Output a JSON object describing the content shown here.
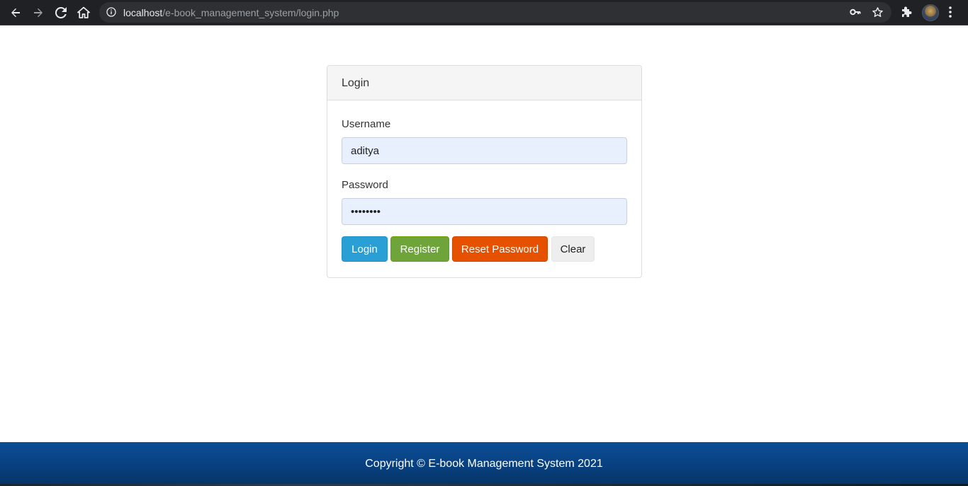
{
  "browser": {
    "url_host": "localhost",
    "url_path": "/e-book_management_system/login.php"
  },
  "login_panel": {
    "title": "Login",
    "username_label": "Username",
    "username_value": "aditya",
    "password_label": "Password",
    "password_value": "••••••••",
    "buttons": {
      "login": "Login",
      "register": "Register",
      "reset_password": "Reset Password",
      "clear": "Clear"
    }
  },
  "footer": {
    "copyright": "Copyright © E-book Management System 2021"
  },
  "colors": {
    "login_button": "#2a9fd6",
    "register_button": "#6ea43a",
    "reset_button": "#e65100",
    "footer": "#08407f"
  }
}
